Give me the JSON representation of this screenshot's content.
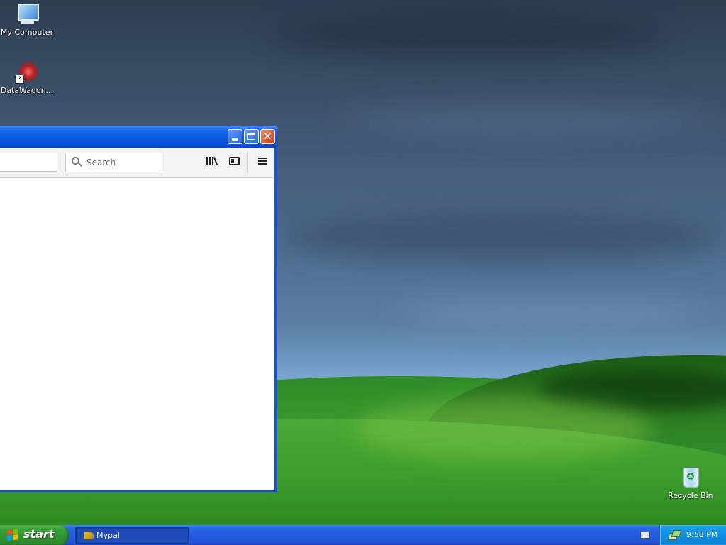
{
  "desktop": {
    "icons": [
      {
        "label": "My Computer",
        "icon": "my-computer-icon"
      },
      {
        "label": "DataWagon...",
        "icon": "datawagon-shortcut-icon"
      },
      {
        "label": "Recycle Bin",
        "icon": "recycle-bin-icon"
      }
    ]
  },
  "window": {
    "app": "Mypal",
    "search": {
      "placeholder": "Search",
      "value": ""
    },
    "toolbar_icons": [
      "library-icon",
      "sidebar-icon",
      "menu-icon"
    ],
    "controls": [
      "minimize",
      "maximize",
      "close"
    ]
  },
  "taskbar": {
    "start_label": "start",
    "tasks": [
      {
        "label": "Mypal",
        "icon": "mypal-app-icon"
      }
    ],
    "tray_icons": [
      "keyboard-icon",
      "network-icon"
    ],
    "clock": "9:58 PM"
  },
  "colors": {
    "taskbar_blue": "#245de0",
    "start_green": "#2f9331",
    "close_red": "#c93c18",
    "tray_blue": "#0f8fe3"
  }
}
